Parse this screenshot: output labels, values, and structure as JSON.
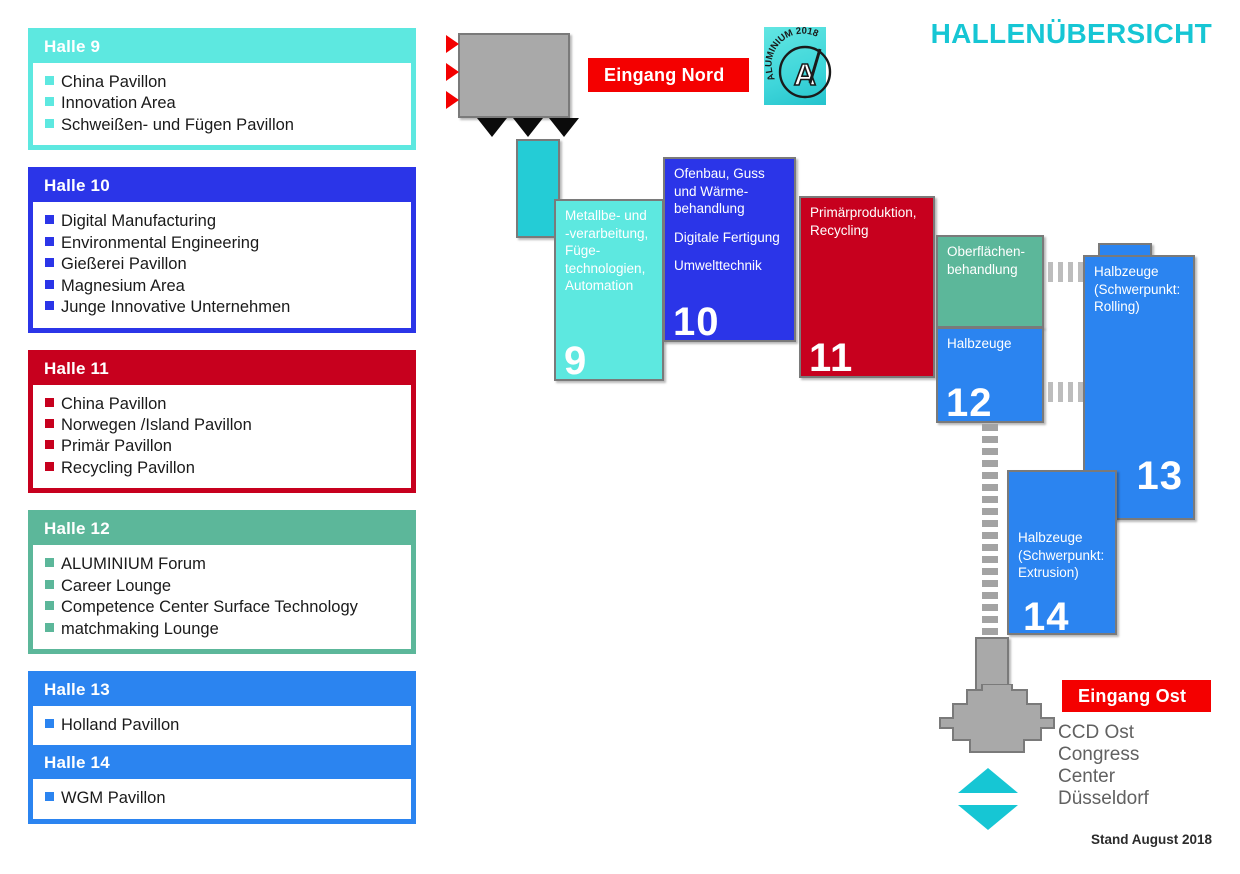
{
  "page": {
    "title": "HALLENÜBERSICHT",
    "footnote": "Stand August 2018",
    "accent_cyan": "#16c6d4",
    "accent_red": "#f40000"
  },
  "logo": {
    "brand": "ALUMINIUM",
    "year": "2018",
    "mark": "A"
  },
  "legend": {
    "cards": [
      {
        "id": "halle-9",
        "title": "Halle 9",
        "color": "#5de8e0",
        "items": [
          "China Pavillon",
          "Innovation Area",
          "Schweißen- und Fügen Pavillon"
        ]
      },
      {
        "id": "halle-10",
        "title": "Halle 10",
        "color": "#2b35e8",
        "items": [
          "Digital Manufacturing",
          "Environmental Engineering",
          "Gießerei Pavillon",
          "Magnesium Area",
          "Junge Innovative Unternehmen"
        ]
      },
      {
        "id": "halle-11",
        "title": "Halle 11",
        "color": "#c7001e",
        "items": [
          "China Pavillon",
          "Norwegen /Island Pavillon",
          "Primär Pavillon",
          "Recycling Pavillon"
        ]
      },
      {
        "id": "halle-12",
        "title": "Halle 12",
        "color": "#5cb79a",
        "items": [
          "ALUMINIUM Forum",
          "Career Lounge",
          "Competence Center Surface Technology",
          "matchmaking Lounge"
        ]
      },
      {
        "id": "halle-13",
        "title": "Halle 13",
        "color": "#2b84f0",
        "items": [
          "Holland Pavillon"
        ]
      },
      {
        "id": "halle-14",
        "title": "Halle 14",
        "color": "#2b84f0",
        "items": [
          "WGM Pavillon"
        ]
      }
    ]
  },
  "map": {
    "entrance_north": "Eingang Nord",
    "entrance_east": "Eingang Ost",
    "ccd": "CCD Ost\nCongress\nCenter\nDüsseldorf",
    "ccd_lines": [
      "CCD Ost",
      "Congress",
      "Center",
      "Düsseldorf"
    ],
    "halls": [
      {
        "id": "hall-9",
        "number": "9",
        "color": "#5de8e0",
        "lines": [
          "Metallbe- und",
          "-verarbeitung,",
          "Füge-",
          "technologien,",
          "Automation"
        ]
      },
      {
        "id": "hall-10",
        "number": "10",
        "color": "#2b35e8",
        "lines": [
          "Ofenbau, Guss",
          "und Wärme-",
          "behandlung",
          "",
          "Digitale Fertigung",
          "",
          "Umwelttechnik"
        ]
      },
      {
        "id": "hall-11",
        "number": "11",
        "color": "#c7001e",
        "lines": [
          "Primärproduktion,",
          "Recycling"
        ]
      },
      {
        "id": "hall-12-surface",
        "number": "",
        "color": "#5cb79a",
        "lines": [
          "Oberflächen-",
          "behandlung"
        ]
      },
      {
        "id": "hall-12",
        "number": "12",
        "color": "#2b84f0",
        "lines": [
          "Halbzeuge"
        ]
      },
      {
        "id": "hall-13",
        "number": "13",
        "color": "#2b84f0",
        "lines": [
          "Halbzeuge",
          "(Schwerpunkt:",
          "Rolling)"
        ]
      },
      {
        "id": "hall-14",
        "number": "14",
        "color": "#2b84f0",
        "lines": [
          "Halbzeuge",
          "(Schwerpunkt:",
          "Extrusion)"
        ]
      }
    ]
  }
}
